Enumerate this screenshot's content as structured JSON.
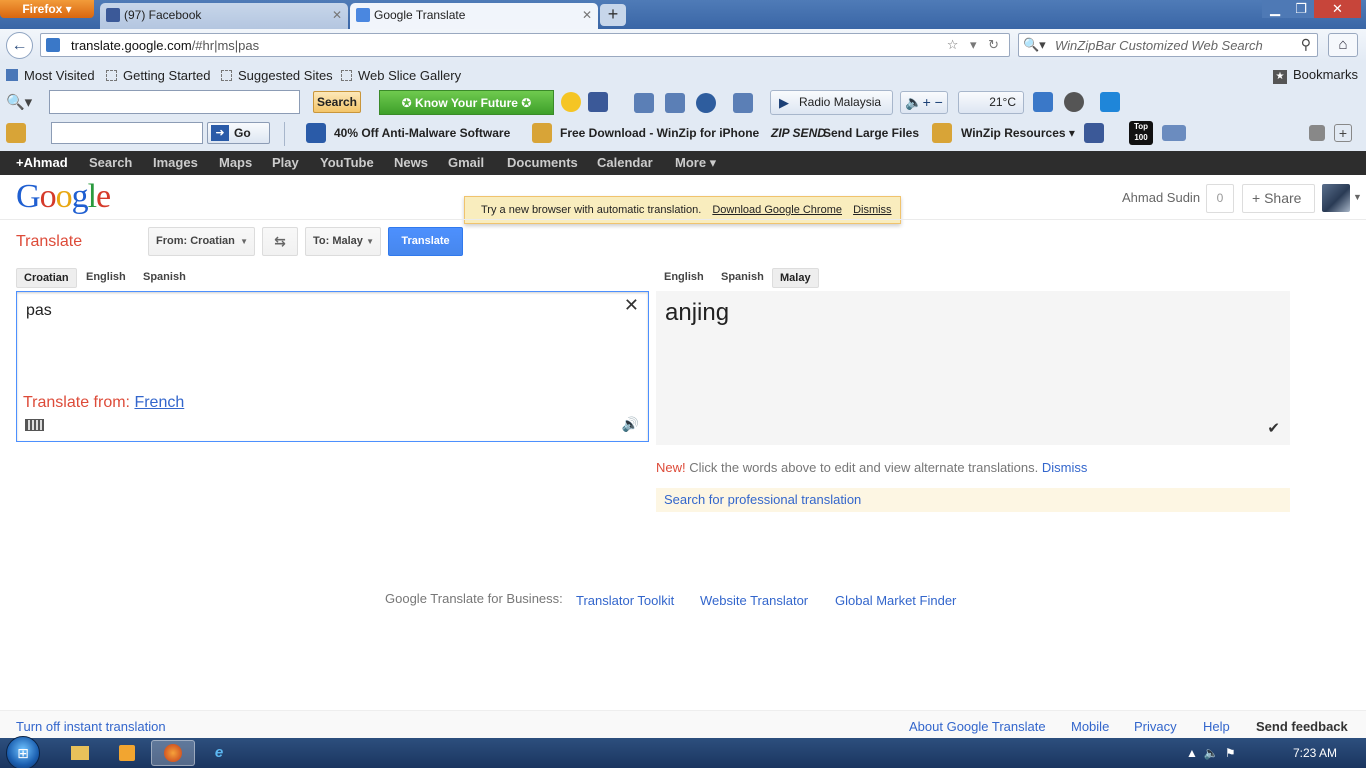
{
  "browser": {
    "app_button": "Firefox ▾",
    "tabs": [
      {
        "title": "(97) Facebook"
      },
      {
        "title": "Google Translate"
      }
    ],
    "url_host": "translate.google.com",
    "url_path": "/#hr|ms|pas",
    "search_placeholder": "WinZipBar Customized Web Search",
    "bookmarks": [
      "Most Visited",
      "Getting Started",
      "Suggested Sites",
      "Web Slice Gallery"
    ],
    "bookmarks_menu": "Bookmarks"
  },
  "toolbar1": {
    "search_label": "Search",
    "kyf_label": "✪ Know Your Future ✪",
    "radio_label": "Radio Malaysia",
    "temperature": "21°C"
  },
  "toolbar2": {
    "go_label": "Go",
    "links": [
      "40% Off Anti-Malware Software",
      "Free Download - WinZip for iPhone",
      "Send Large Files",
      "WinZip Resources ▾"
    ],
    "top_badge": "Top 100"
  },
  "google_bar": [
    "+Ahmad",
    "Search",
    "Images",
    "Maps",
    "Play",
    "YouTube",
    "News",
    "Gmail",
    "Documents",
    "Calendar",
    "More ▾"
  ],
  "header": {
    "notice_text": "Try a new browser with automatic translation.",
    "notice_link": "Download Google Chrome",
    "notice_dismiss": "Dismiss",
    "user_name": "Ahmad Sudin",
    "count": "0",
    "share_label": "+  Share"
  },
  "translate": {
    "title": "Translate",
    "from_label": "From: Croatian",
    "to_label": "To: Malay",
    "swap_symbol": "⇆",
    "translate_button": "Translate",
    "source_tabs": [
      "Croatian",
      "English",
      "Spanish"
    ],
    "target_tabs": [
      "English",
      "Spanish",
      "Malay"
    ],
    "source_text": "pas",
    "translate_from_label": "Translate from:",
    "translate_from_lang": "French",
    "result_text": "anjing",
    "new_label": "New!",
    "new_text": " Click the words above to edit and view alternate translations.",
    "new_dismiss": "Dismiss",
    "professional_link": "Search for professional translation"
  },
  "business": {
    "label": "Google Translate for Business:",
    "links": [
      "Translator Toolkit",
      "Website Translator",
      "Global Market Finder"
    ]
  },
  "footer": {
    "instant": "Turn off instant translation",
    "links": [
      "About Google Translate",
      "Mobile",
      "Privacy",
      "Help"
    ],
    "feedback": "Send feedback"
  },
  "taskbar": {
    "clock": "7:23 AM"
  }
}
